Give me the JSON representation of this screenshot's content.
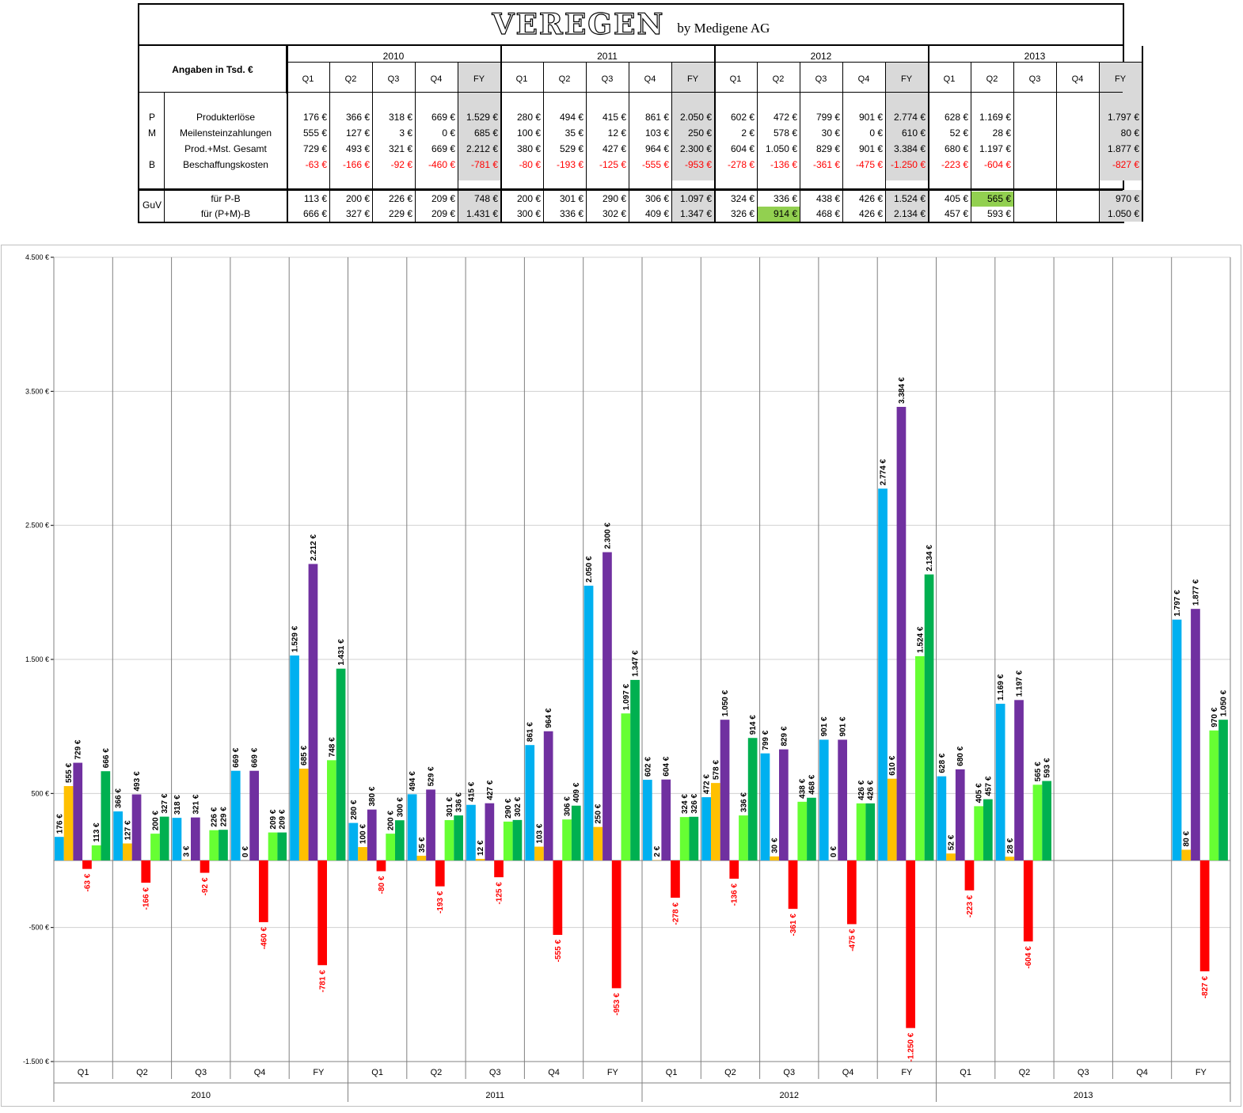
{
  "title": {
    "main": "VEREGEN",
    "sub": "by Medigene AG"
  },
  "table": {
    "header_label": "Angaben in Tsd. €",
    "years": [
      "2010",
      "2011",
      "2012",
      "2013"
    ],
    "quarters": [
      "Q1",
      "Q2",
      "Q3",
      "Q4",
      "FY"
    ],
    "rows": [
      {
        "letter": "P",
        "label": "Produkterlöse",
        "values": [
          "176 €",
          "366 €",
          "318 €",
          "669 €",
          "1.529 €",
          "280 €",
          "494 €",
          "415 €",
          "861 €",
          "2.050 €",
          "602 €",
          "472 €",
          "799 €",
          "901 €",
          "2.774 €",
          "628 €",
          "1.169 €",
          "",
          "",
          "1.797 €"
        ]
      },
      {
        "letter": "M",
        "label": "Meilensteinzahlungen",
        "values": [
          "555 €",
          "127 €",
          "3 €",
          "0 €",
          "685 €",
          "100 €",
          "35 €",
          "12 €",
          "103 €",
          "250 €",
          "2 €",
          "578 €",
          "30 €",
          "0 €",
          "610 €",
          "52 €",
          "28 €",
          "",
          "",
          "80 €"
        ]
      },
      {
        "letter": "",
        "label": "Prod.+Mst. Gesamt",
        "values": [
          "729 €",
          "493 €",
          "321 €",
          "669 €",
          "2.212 €",
          "380 €",
          "529 €",
          "427 €",
          "964 €",
          "2.300 €",
          "604 €",
          "1.050 €",
          "829 €",
          "901 €",
          "3.384 €",
          "680 €",
          "1.197 €",
          "",
          "",
          "1.877 €"
        ]
      },
      {
        "letter": "B",
        "label": "Beschaffungskosten",
        "values": [
          "-63 €",
          "-166 €",
          "-92 €",
          "-460 €",
          "-781 €",
          "-80 €",
          "-193 €",
          "-125 €",
          "-555 €",
          "-953 €",
          "-278 €",
          "-136 €",
          "-361 €",
          "-475 €",
          "-1.250 €",
          "-223 €",
          "-604 €",
          "",
          "",
          "-827 €"
        ]
      }
    ],
    "guv_letter": "GuV",
    "guv_rows": [
      {
        "label": "für P-B",
        "values": [
          "113 €",
          "200 €",
          "226 €",
          "209 €",
          "748 €",
          "200 €",
          "301 €",
          "290 €",
          "306 €",
          "1.097 €",
          "324 €",
          "336 €",
          "438 €",
          "426 €",
          "1.524 €",
          "405 €",
          "565 €",
          "",
          "",
          "970 €"
        ]
      },
      {
        "label": "für (P+M)-B",
        "values": [
          "666 €",
          "327 €",
          "229 €",
          "209 €",
          "1.431 €",
          "300 €",
          "336 €",
          "302 €",
          "409 €",
          "1.347 €",
          "326 €",
          "914 €",
          "468 €",
          "426 €",
          "2.134 €",
          "457 €",
          "593 €",
          "",
          "",
          "1.050 €"
        ]
      }
    ]
  },
  "chart_data": {
    "type": "bar",
    "categories": [
      "Q1",
      "Q2",
      "Q3",
      "Q4",
      "FY",
      "Q1",
      "Q2",
      "Q3",
      "Q4",
      "FY",
      "Q1",
      "Q2",
      "Q3",
      "Q4",
      "FY",
      "Q1",
      "Q2",
      "Q3",
      "Q4",
      "FY"
    ],
    "groups": [
      "2010",
      "2011",
      "2012",
      "2013"
    ],
    "ylim": [
      -1500,
      4500
    ],
    "yticks": [
      -1500,
      -500,
      500,
      1500,
      2500,
      3500,
      4500
    ],
    "ytick_labels": [
      "-1.500 €",
      "-500 €",
      "500 €",
      "1.500 €",
      "2.500 €",
      "3.500 €",
      "4.500 €"
    ],
    "colors": [
      "#00b0f0",
      "#ffc000",
      "#7030a0",
      "#ff0000",
      "#66ff33",
      "#00b050"
    ],
    "series": [
      {
        "values": [
          176,
          366,
          318,
          669,
          1529,
          280,
          494,
          415,
          861,
          2050,
          602,
          472,
          799,
          901,
          2774,
          628,
          1169,
          null,
          null,
          1797
        ]
      },
      {
        "values": [
          555,
          127,
          3,
          0,
          685,
          100,
          35,
          12,
          103,
          250,
          2,
          578,
          30,
          0,
          610,
          52,
          28,
          null,
          null,
          80
        ]
      },
      {
        "values": [
          729,
          493,
          321,
          669,
          2212,
          380,
          529,
          427,
          964,
          2300,
          604,
          1050,
          829,
          901,
          3384,
          680,
          1197,
          null,
          null,
          1877
        ]
      },
      {
        "values": [
          -63,
          -166,
          -92,
          -460,
          -781,
          -80,
          -193,
          -125,
          -555,
          -953,
          -278,
          -136,
          -361,
          -475,
          -1250,
          -223,
          -604,
          null,
          null,
          -827
        ]
      },
      {
        "values": [
          113,
          200,
          226,
          209,
          748,
          200,
          301,
          290,
          306,
          1097,
          324,
          336,
          438,
          426,
          1524,
          405,
          565,
          null,
          null,
          970
        ]
      },
      {
        "values": [
          666,
          327,
          229,
          209,
          1431,
          300,
          336,
          302,
          409,
          1347,
          326,
          914,
          468,
          426,
          2134,
          457,
          593,
          null,
          null,
          1050
        ]
      }
    ],
    "value_labels": [
      [
        "176 €",
        "366 €",
        "318 €",
        "669 €",
        "1.529 €",
        "280 €",
        "494 €",
        "415 €",
        "861 €",
        "2.050 €",
        "602 €",
        "472 €",
        "799 €",
        "901 €",
        "2.774 €",
        "628 €",
        "1.169 €",
        "",
        "",
        "1.797 €"
      ],
      [
        "555 €",
        "127 €",
        "3 €",
        "0 €",
        "685 €",
        "100 €",
        "35 €",
        "12 €",
        "103 €",
        "250 €",
        "2 €",
        "578 €",
        "30 €",
        "0 €",
        "610 €",
        "52 €",
        "28 €",
        "",
        "",
        "80 €"
      ],
      [
        "729 €",
        "493 €",
        "321 €",
        "669 €",
        "2.212 €",
        "380 €",
        "529 €",
        "427 €",
        "964 €",
        "2.300 €",
        "604 €",
        "1.050 €",
        "829 €",
        "901 €",
        "3.384 €",
        "680 €",
        "1.197 €",
        "",
        "",
        "1.877 €"
      ],
      [
        "-63 €",
        "-166 €",
        "-92 €",
        "-460 €",
        "-781 €",
        "-80 €",
        "-193 €",
        "-125 €",
        "-555 €",
        "-953 €",
        "-278 €",
        "-136 €",
        "-361 €",
        "-475 €",
        "-1.250 €",
        "-223 €",
        "-604 €",
        "",
        "",
        "-827 €"
      ],
      [
        "113 €",
        "200 €",
        "226 €",
        "209 €",
        "748 €",
        "200 €",
        "301 €",
        "290 €",
        "306 €",
        "1.097 €",
        "324 €",
        "336 €",
        "438 €",
        "426 €",
        "1.524 €",
        "405 €",
        "565 €",
        "",
        "",
        "970 €"
      ],
      [
        "666 €",
        "327 €",
        "229 €",
        "209 €",
        "1.431 €",
        "300 €",
        "336 €",
        "302 €",
        "409 €",
        "1.347 €",
        "326 €",
        "914 €",
        "468 €",
        "426 €",
        "2.134 €",
        "457 €",
        "593 €",
        "",
        "",
        "1.050 €"
      ]
    ],
    "grid": true,
    "legend": "none"
  }
}
